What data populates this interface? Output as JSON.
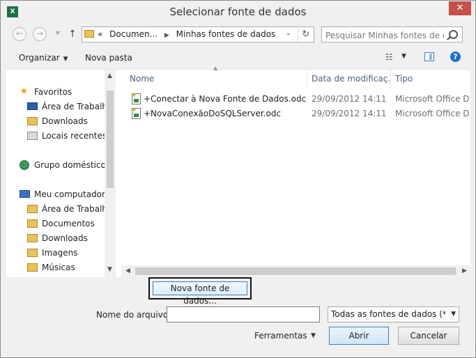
{
  "window": {
    "title": "Selecionar fonte de dados",
    "app_icon": "excel-icon",
    "app_icon_text": "X"
  },
  "address": {
    "prefix": "«",
    "crumbs": [
      "Documen...",
      "Minhas fontes de dados"
    ],
    "folder_icon": "folder-icon"
  },
  "search": {
    "placeholder": "Pesquisar Minhas fontes de dados"
  },
  "toolbar": {
    "organize_label": "Organizar",
    "new_folder_label": "Nova pasta"
  },
  "nav": {
    "items": [
      {
        "label": "Favoritos",
        "icon": "star-icon"
      },
      {
        "label": "Área de Trabalho",
        "icon": "desktop-icon"
      },
      {
        "label": "Downloads",
        "icon": "folder-icon"
      },
      {
        "label": "Locais recentes",
        "icon": "recent-places-icon"
      },
      {
        "label": "Grupo doméstico",
        "icon": "homegroup-icon"
      },
      {
        "label": "Meu computador",
        "icon": "computer-icon"
      },
      {
        "label": "Área de Trabalho",
        "icon": "desktop-icon"
      },
      {
        "label": "Documentos",
        "icon": "folder-icon"
      },
      {
        "label": "Downloads",
        "icon": "folder-icon"
      },
      {
        "label": "Imagens",
        "icon": "folder-icon"
      },
      {
        "label": "Músicas",
        "icon": "folder-icon"
      }
    ]
  },
  "files": {
    "columns": {
      "name": "Nome",
      "date": "Data de modificaç...",
      "type": "Tipo"
    },
    "rows": [
      {
        "name": "+Conectar à Nova Fonte de Dados.odc",
        "date": "29/09/2012 14:11",
        "type": "Microsoft Office D..."
      },
      {
        "name": "+NovaConexãoDoSQLServer.odc",
        "date": "29/09/2012 14:11",
        "type": "Microsoft Office D..."
      }
    ]
  },
  "bottom": {
    "new_source_label": "Nova fonte de dados...",
    "filename_label": "Nome do arquivo:",
    "filename_value": "",
    "filter_value": "Todas as fontes de dados (*.odc",
    "tools_label": "Ferramentas",
    "open_label": "Abrir",
    "cancel_label": "Cancelar"
  },
  "colors": {
    "accent": "#3c7fb1",
    "close": "#c7504a",
    "excel": "#1e7145",
    "header_text": "#4c607a"
  }
}
